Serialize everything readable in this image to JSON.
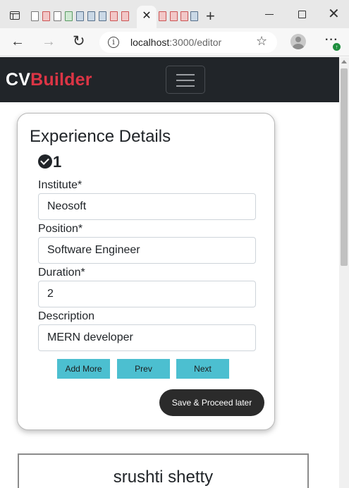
{
  "browser": {
    "url_host": "localhost",
    "url_path": ":3000/editor",
    "update_badge": "↑"
  },
  "navbar": {
    "brand_part1": "CV",
    "brand_part2": "Builder",
    "brand_accent": "#dc3545",
    "background": "#212529"
  },
  "form": {
    "title": "Experience Details",
    "entry_number": "1",
    "fields": [
      {
        "label": "Institute*",
        "value": "Neosoft"
      },
      {
        "label": "Position*",
        "value": "Software Engineer"
      },
      {
        "label": "Duration*",
        "value": "2"
      },
      {
        "label": "Description",
        "value": "MERN developer"
      }
    ],
    "buttons": {
      "add_more": "Add More",
      "prev": "Prev",
      "next": "Next",
      "save_later": "Save & Proceed later"
    },
    "button_color": "#4cbfd0"
  },
  "preview": {
    "name": "srushti shetty"
  }
}
